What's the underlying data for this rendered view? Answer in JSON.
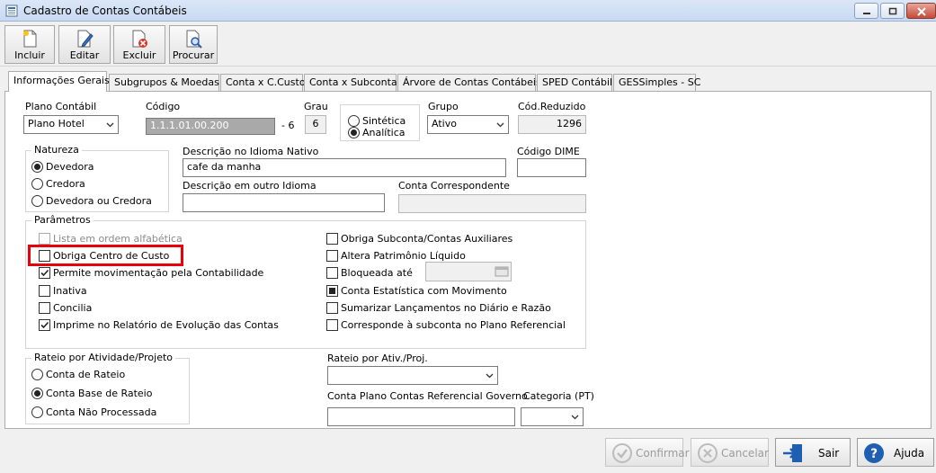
{
  "window": {
    "title": "Cadastro de Contas Contábeis"
  },
  "toolbar": {
    "incluir": "Incluir",
    "editar": "Editar",
    "excluir": "Excluir",
    "procurar": "Procurar"
  },
  "tabs": [
    "Informações Gerais",
    "Subgrupos & Moedas",
    "Conta x C.Custo",
    "Conta x Subconta",
    "Árvore de Contas Contábeis",
    "SPED Contábil",
    "GESSimples - SC"
  ],
  "form": {
    "plano_label": "Plano Contábil",
    "plano_value": "Plano Hotel",
    "codigo_label": "Código",
    "codigo_value": "1.1.1.01.00.200",
    "codigo_suffix": "- 6",
    "grau_label": "Grau",
    "grau_value": "6",
    "sintetica": "Sintética",
    "analitica": "Analítica",
    "grupo_label": "Grupo",
    "grupo_value": "Ativo",
    "cod_reduzido_label": "Cód.Reduzido",
    "cod_reduzido_value": "1296",
    "natureza_title": "Natureza",
    "devedora": "Devedora",
    "credora": "Credora",
    "devedora_ou_credora": "Devedora ou Credora",
    "desc_nativo_label": "Descrição no Idioma Nativo",
    "desc_nativo_value": "cafe da manha",
    "codigo_dime_label": "Código DIME",
    "codigo_dime_value": "",
    "desc_outro_label": "Descrição em outro Idioma",
    "desc_outro_value": "",
    "conta_corr_label": "Conta Correspondente",
    "conta_corr_value": ""
  },
  "parametros": {
    "title": "Parâmetros",
    "left": [
      {
        "label": "Lista em ordem alfabética",
        "checked": false
      },
      {
        "label": "Obriga Centro de Custo",
        "checked": false
      },
      {
        "label": "Permite movimentação pela Contabilidade",
        "checked": true
      },
      {
        "label": "Inativa",
        "checked": false
      },
      {
        "label": "Concilia",
        "checked": false
      },
      {
        "label": "Imprime no Relatório de Evolução das Contas",
        "checked": true
      }
    ],
    "right": [
      {
        "label": "Obriga Subconta/Contas Auxiliares",
        "checked": false
      },
      {
        "label": "Altera Patrimônio Líquido",
        "checked": false
      },
      {
        "label": "Bloqueada até",
        "checked": false
      },
      {
        "label": "Conta Estatística com Movimento",
        "checked": true
      },
      {
        "label": "Sumarizar Lançamentos no Diário e Razão",
        "checked": false
      },
      {
        "label": "Corresponde à subconta no Plano Referencial",
        "checked": false
      }
    ]
  },
  "rateio": {
    "title": "Rateio por Atividade/Projeto",
    "conta_rateio": "Conta de Rateio",
    "conta_base": "Conta Base de Rateio",
    "conta_nao_proc": "Conta Não Processada",
    "ativ_label": "Rateio por Ativ./Proj.",
    "ativ_value": "",
    "ref_gov_label": "Conta Plano Contas Referencial Governo",
    "ref_gov_value": "",
    "categoria_label": "Categoria (PT)",
    "categoria_value": ""
  },
  "footer": {
    "confirmar": "Confirmar",
    "cancelar": "Cancelar",
    "sair": "Sair",
    "ajuda": "Ajuda"
  },
  "colors": {
    "highlight": "#e8000b",
    "tab_border": "#adadad"
  }
}
